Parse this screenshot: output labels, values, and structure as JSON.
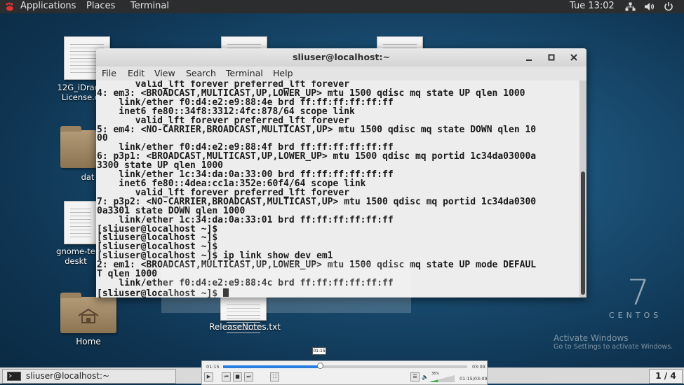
{
  "topbar": {
    "applications": "Applications",
    "places": "Places",
    "terminal": "Terminal",
    "clock": "Tue 13:02",
    "icons": [
      "network-icon",
      "volume-icon",
      "power-icon"
    ]
  },
  "desktop": {
    "icons": [
      {
        "label_line1": "12G_iDrac7",
        "label_line2": "License.d"
      },
      {
        "label_line1": "dat",
        "label_line2": ""
      },
      {
        "label_line1": "gnome-te",
        "label_line2": "deskt"
      },
      {
        "label_line1": "Home",
        "label_line2": ""
      },
      {
        "label_line1": "ReleaseNotes.txt",
        "label_line2": ""
      }
    ],
    "watermark_number": "7",
    "watermark_text": "CENTOS",
    "activate_title": "Activate Windows",
    "activate_sub": "Go to Settings to activate Windows."
  },
  "terminal": {
    "title": "sliuser@localhost:~",
    "menu": [
      "File",
      "Edit",
      "View",
      "Search",
      "Terminal",
      "Help"
    ],
    "lines": [
      "       valid_lft forever preferred_lft forever",
      "4: em3: <BROADCAST,MULTICAST,UP,LOWER_UP> mtu 1500 qdisc mq state UP qlen 1000",
      "    link/ether f0:d4:e2:e9:88:4e brd ff:ff:ff:ff:ff:ff",
      "    inet6 fe80::34f8:3312:4fc:878/64 scope link",
      "       valid_lft forever preferred_lft forever",
      "5: em4: <NO-CARRIER,BROADCAST,MULTICAST,UP> mtu 1500 qdisc mq state DOWN qlen 10",
      "00",
      "    link/ether f0:d4:e2:e9:88:4f brd ff:ff:ff:ff:ff:ff",
      "6: p3p1: <BROADCAST,MULTICAST,UP,LOWER_UP> mtu 1500 qdisc mq portid 1c34da03000a",
      "3300 state UP qlen 1000",
      "    link/ether 1c:34:da:0a:33:00 brd ff:ff:ff:ff:ff:ff",
      "    inet6 fe80::4dea:cc1a:352e:60f4/64 scope link",
      "       valid_lft forever preferred_lft forever",
      "7: p3p2: <NO-CARRIER,BROADCAST,MULTICAST,UP> mtu 1500 qdisc mq portid 1c34da0300",
      "0a3301 state DOWN qlen 1000",
      "    link/ether 1c:34:da:0a:33:01 brd ff:ff:ff:ff:ff:ff",
      "[sliuser@localhost ~]$",
      "[sliuser@localhost ~]$",
      "[sliuser@localhost ~]$",
      "[sliuser@localhost ~]$ ip link show dev em1",
      "2: em1: <BROADCAST,MULTICAST,UP,LOWER_UP> mtu 1500 qdisc mq state UP mode DEFAUL",
      "T qlen 1000",
      "    link/ether f0:d4:e2:e9:88:4c brd ff:ff:ff:ff:ff:ff"
    ],
    "prompt": "[sliuser@localhost ~]$ "
  },
  "taskbar": {
    "task_label": "sliuser@localhost:~",
    "workspace": "1 / 4"
  },
  "player": {
    "current_time": "01:15",
    "total_time": "03:09",
    "time_readout": "01:15/03:09",
    "tooltip": "01:15",
    "progress_percent": 39.7,
    "volume_label": "36%",
    "volume_percent": 36
  },
  "colors": {
    "progress": "#2a7de0",
    "volume": "#3cb043"
  }
}
